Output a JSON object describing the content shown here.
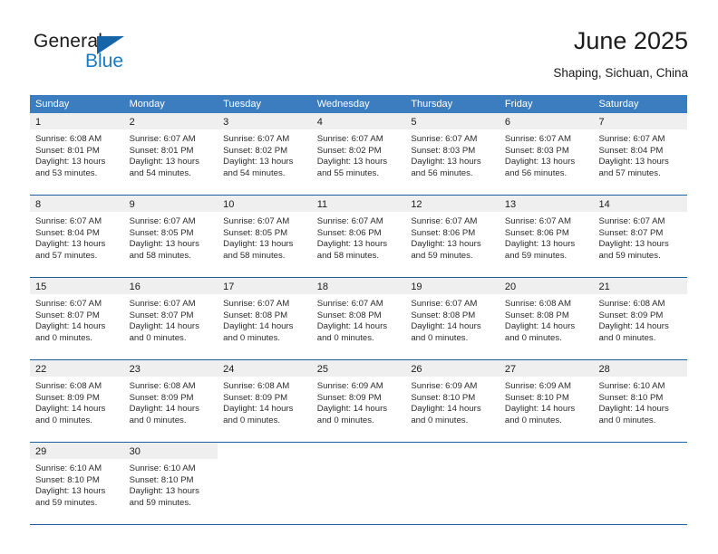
{
  "brand": {
    "name_top": "General",
    "name_bottom": "Blue",
    "triangle_icon": "blue-triangle-logo-mark",
    "accent_color": "#1a7ac4",
    "mark_color": "#1565a8"
  },
  "header": {
    "title": "June 2025",
    "subtitle": "Shaping, Sichuan, China"
  },
  "theme": {
    "header_bg": "#3b7dbf",
    "header_text": "#ffffff",
    "row_divider": "#1c5ea0",
    "daynum_band": "#efefef",
    "body_text": "#2b2b2b"
  },
  "calendar": {
    "weekdays": [
      "Sunday",
      "Monday",
      "Tuesday",
      "Wednesday",
      "Thursday",
      "Friday",
      "Saturday"
    ],
    "weeks": [
      [
        {
          "day": "1",
          "sunrise": "Sunrise: 6:08 AM",
          "sunset": "Sunset: 8:01 PM",
          "daylight1": "Daylight: 13 hours",
          "daylight2": "and 53 minutes."
        },
        {
          "day": "2",
          "sunrise": "Sunrise: 6:07 AM",
          "sunset": "Sunset: 8:01 PM",
          "daylight1": "Daylight: 13 hours",
          "daylight2": "and 54 minutes."
        },
        {
          "day": "3",
          "sunrise": "Sunrise: 6:07 AM",
          "sunset": "Sunset: 8:02 PM",
          "daylight1": "Daylight: 13 hours",
          "daylight2": "and 54 minutes."
        },
        {
          "day": "4",
          "sunrise": "Sunrise: 6:07 AM",
          "sunset": "Sunset: 8:02 PM",
          "daylight1": "Daylight: 13 hours",
          "daylight2": "and 55 minutes."
        },
        {
          "day": "5",
          "sunrise": "Sunrise: 6:07 AM",
          "sunset": "Sunset: 8:03 PM",
          "daylight1": "Daylight: 13 hours",
          "daylight2": "and 56 minutes."
        },
        {
          "day": "6",
          "sunrise": "Sunrise: 6:07 AM",
          "sunset": "Sunset: 8:03 PM",
          "daylight1": "Daylight: 13 hours",
          "daylight2": "and 56 minutes."
        },
        {
          "day": "7",
          "sunrise": "Sunrise: 6:07 AM",
          "sunset": "Sunset: 8:04 PM",
          "daylight1": "Daylight: 13 hours",
          "daylight2": "and 57 minutes."
        }
      ],
      [
        {
          "day": "8",
          "sunrise": "Sunrise: 6:07 AM",
          "sunset": "Sunset: 8:04 PM",
          "daylight1": "Daylight: 13 hours",
          "daylight2": "and 57 minutes."
        },
        {
          "day": "9",
          "sunrise": "Sunrise: 6:07 AM",
          "sunset": "Sunset: 8:05 PM",
          "daylight1": "Daylight: 13 hours",
          "daylight2": "and 58 minutes."
        },
        {
          "day": "10",
          "sunrise": "Sunrise: 6:07 AM",
          "sunset": "Sunset: 8:05 PM",
          "daylight1": "Daylight: 13 hours",
          "daylight2": "and 58 minutes."
        },
        {
          "day": "11",
          "sunrise": "Sunrise: 6:07 AM",
          "sunset": "Sunset: 8:06 PM",
          "daylight1": "Daylight: 13 hours",
          "daylight2": "and 58 minutes."
        },
        {
          "day": "12",
          "sunrise": "Sunrise: 6:07 AM",
          "sunset": "Sunset: 8:06 PM",
          "daylight1": "Daylight: 13 hours",
          "daylight2": "and 59 minutes."
        },
        {
          "day": "13",
          "sunrise": "Sunrise: 6:07 AM",
          "sunset": "Sunset: 8:06 PM",
          "daylight1": "Daylight: 13 hours",
          "daylight2": "and 59 minutes."
        },
        {
          "day": "14",
          "sunrise": "Sunrise: 6:07 AM",
          "sunset": "Sunset: 8:07 PM",
          "daylight1": "Daylight: 13 hours",
          "daylight2": "and 59 minutes."
        }
      ],
      [
        {
          "day": "15",
          "sunrise": "Sunrise: 6:07 AM",
          "sunset": "Sunset: 8:07 PM",
          "daylight1": "Daylight: 14 hours",
          "daylight2": "and 0 minutes."
        },
        {
          "day": "16",
          "sunrise": "Sunrise: 6:07 AM",
          "sunset": "Sunset: 8:07 PM",
          "daylight1": "Daylight: 14 hours",
          "daylight2": "and 0 minutes."
        },
        {
          "day": "17",
          "sunrise": "Sunrise: 6:07 AM",
          "sunset": "Sunset: 8:08 PM",
          "daylight1": "Daylight: 14 hours",
          "daylight2": "and 0 minutes."
        },
        {
          "day": "18",
          "sunrise": "Sunrise: 6:07 AM",
          "sunset": "Sunset: 8:08 PM",
          "daylight1": "Daylight: 14 hours",
          "daylight2": "and 0 minutes."
        },
        {
          "day": "19",
          "sunrise": "Sunrise: 6:07 AM",
          "sunset": "Sunset: 8:08 PM",
          "daylight1": "Daylight: 14 hours",
          "daylight2": "and 0 minutes."
        },
        {
          "day": "20",
          "sunrise": "Sunrise: 6:08 AM",
          "sunset": "Sunset: 8:08 PM",
          "daylight1": "Daylight: 14 hours",
          "daylight2": "and 0 minutes."
        },
        {
          "day": "21",
          "sunrise": "Sunrise: 6:08 AM",
          "sunset": "Sunset: 8:09 PM",
          "daylight1": "Daylight: 14 hours",
          "daylight2": "and 0 minutes."
        }
      ],
      [
        {
          "day": "22",
          "sunrise": "Sunrise: 6:08 AM",
          "sunset": "Sunset: 8:09 PM",
          "daylight1": "Daylight: 14 hours",
          "daylight2": "and 0 minutes."
        },
        {
          "day": "23",
          "sunrise": "Sunrise: 6:08 AM",
          "sunset": "Sunset: 8:09 PM",
          "daylight1": "Daylight: 14 hours",
          "daylight2": "and 0 minutes."
        },
        {
          "day": "24",
          "sunrise": "Sunrise: 6:08 AM",
          "sunset": "Sunset: 8:09 PM",
          "daylight1": "Daylight: 14 hours",
          "daylight2": "and 0 minutes."
        },
        {
          "day": "25",
          "sunrise": "Sunrise: 6:09 AM",
          "sunset": "Sunset: 8:09 PM",
          "daylight1": "Daylight: 14 hours",
          "daylight2": "and 0 minutes."
        },
        {
          "day": "26",
          "sunrise": "Sunrise: 6:09 AM",
          "sunset": "Sunset: 8:10 PM",
          "daylight1": "Daylight: 14 hours",
          "daylight2": "and 0 minutes."
        },
        {
          "day": "27",
          "sunrise": "Sunrise: 6:09 AM",
          "sunset": "Sunset: 8:10 PM",
          "daylight1": "Daylight: 14 hours",
          "daylight2": "and 0 minutes."
        },
        {
          "day": "28",
          "sunrise": "Sunrise: 6:10 AM",
          "sunset": "Sunset: 8:10 PM",
          "daylight1": "Daylight: 14 hours",
          "daylight2": "and 0 minutes."
        }
      ],
      [
        {
          "day": "29",
          "sunrise": "Sunrise: 6:10 AM",
          "sunset": "Sunset: 8:10 PM",
          "daylight1": "Daylight: 13 hours",
          "daylight2": "and 59 minutes."
        },
        {
          "day": "30",
          "sunrise": "Sunrise: 6:10 AM",
          "sunset": "Sunset: 8:10 PM",
          "daylight1": "Daylight: 13 hours",
          "daylight2": "and 59 minutes."
        },
        {
          "day": "",
          "sunrise": "",
          "sunset": "",
          "daylight1": "",
          "daylight2": ""
        },
        {
          "day": "",
          "sunrise": "",
          "sunset": "",
          "daylight1": "",
          "daylight2": ""
        },
        {
          "day": "",
          "sunrise": "",
          "sunset": "",
          "daylight1": "",
          "daylight2": ""
        },
        {
          "day": "",
          "sunrise": "",
          "sunset": "",
          "daylight1": "",
          "daylight2": ""
        },
        {
          "day": "",
          "sunrise": "",
          "sunset": "",
          "daylight1": "",
          "daylight2": ""
        }
      ]
    ]
  }
}
